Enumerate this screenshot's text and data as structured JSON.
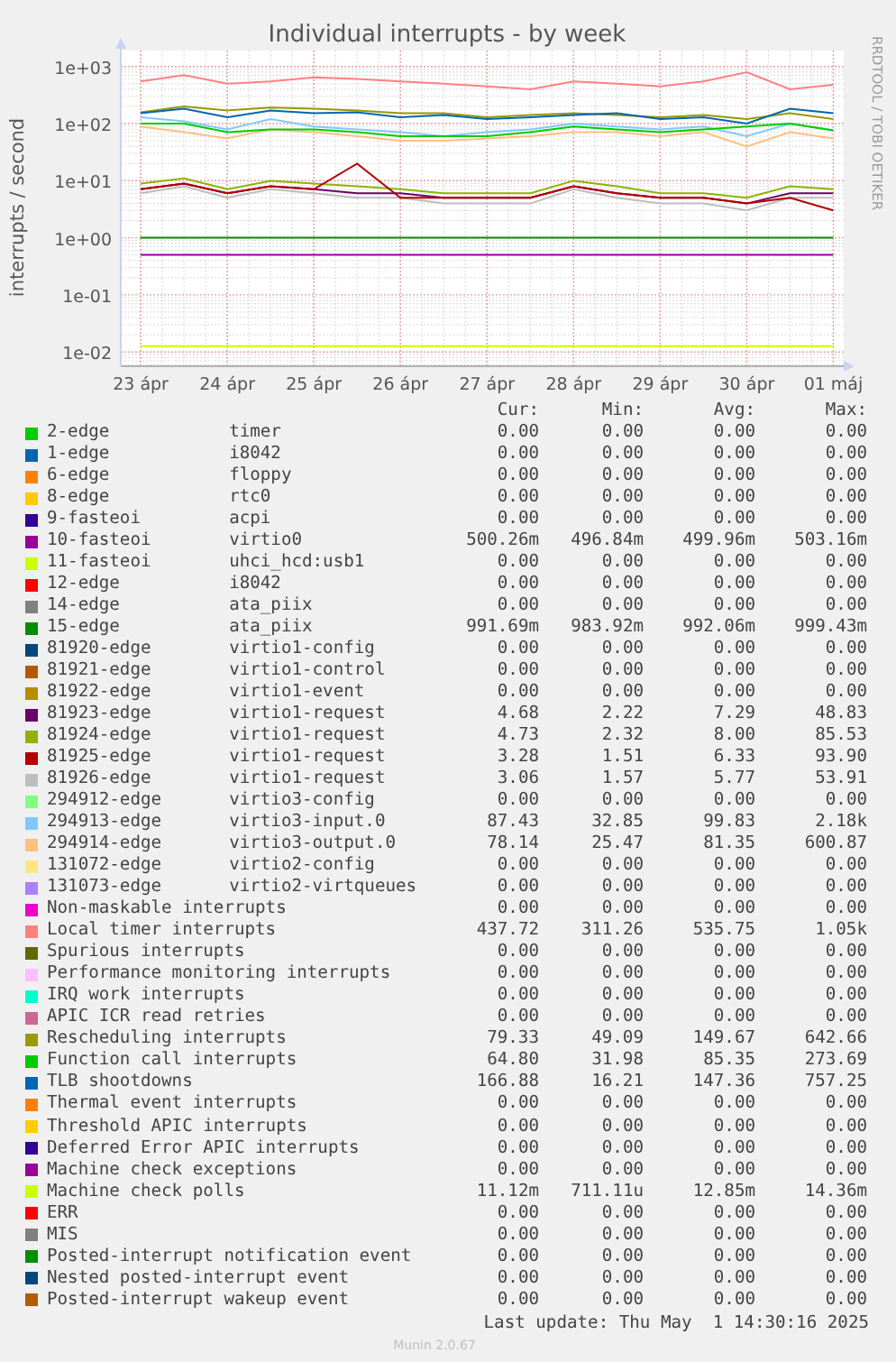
{
  "graph": {
    "title": "Individual interrupts - by week",
    "ylabel": "interrupts / second",
    "x_labels": [
      "23 ápr",
      "24 ápr",
      "25 ápr",
      "26 ápr",
      "27 ápr",
      "28 ápr",
      "29 ápr",
      "30 ápr",
      "01 máj"
    ],
    "y_labels": [
      "1e+03",
      "1e+02",
      "1e+01",
      "1e+00",
      "1e-01",
      "1e-02"
    ]
  },
  "side_label": "RRDTOOL / TOBI OETIKER",
  "legend": {
    "columns": [
      "Cur:",
      "Min:",
      "Avg:",
      "Max:"
    ],
    "rows": [
      {
        "source": "2-edge",
        "device": "timer",
        "color": "#00cc00",
        "cur": "0.00",
        "min": "0.00",
        "avg": "0.00",
        "max": "0.00"
      },
      {
        "source": "1-edge",
        "device": "i8042",
        "color": "#0066b3",
        "cur": "0.00",
        "min": "0.00",
        "avg": "0.00",
        "max": "0.00"
      },
      {
        "source": "6-edge",
        "device": "floppy",
        "color": "#ff8000",
        "cur": "0.00",
        "min": "0.00",
        "avg": "0.00",
        "max": "0.00"
      },
      {
        "source": "8-edge",
        "device": "rtc0",
        "color": "#ffcc00",
        "cur": "0.00",
        "min": "0.00",
        "avg": "0.00",
        "max": "0.00"
      },
      {
        "source": "9-fasteoi",
        "device": "acpi",
        "color": "#330099",
        "cur": "0.00",
        "min": "0.00",
        "avg": "0.00",
        "max": "0.00"
      },
      {
        "source": "10-fasteoi",
        "device": "virtio0",
        "color": "#990099",
        "cur": "500.26m",
        "min": "496.84m",
        "avg": "499.96m",
        "max": "503.16m"
      },
      {
        "source": "11-fasteoi",
        "device": "uhci_hcd:usb1",
        "color": "#ccff00",
        "cur": "0.00",
        "min": "0.00",
        "avg": "0.00",
        "max": "0.00"
      },
      {
        "source": "12-edge",
        "device": "i8042",
        "color": "#ff0000",
        "cur": "0.00",
        "min": "0.00",
        "avg": "0.00",
        "max": "0.00"
      },
      {
        "source": "14-edge",
        "device": "ata_piix",
        "color": "#808080",
        "cur": "0.00",
        "min": "0.00",
        "avg": "0.00",
        "max": "0.00"
      },
      {
        "source": "15-edge",
        "device": "ata_piix",
        "color": "#008f00",
        "cur": "991.69m",
        "min": "983.92m",
        "avg": "992.06m",
        "max": "999.43m"
      },
      {
        "source": "81920-edge",
        "device": "virtio1-config",
        "color": "#00487d",
        "cur": "0.00",
        "min": "0.00",
        "avg": "0.00",
        "max": "0.00"
      },
      {
        "source": "81921-edge",
        "device": "virtio1-control",
        "color": "#b35a00",
        "cur": "0.00",
        "min": "0.00",
        "avg": "0.00",
        "max": "0.00"
      },
      {
        "source": "81922-edge",
        "device": "virtio1-event",
        "color": "#b38f00",
        "cur": "0.00",
        "min": "0.00",
        "avg": "0.00",
        "max": "0.00"
      },
      {
        "source": "81923-edge",
        "device": "virtio1-request",
        "color": "#6b006b",
        "cur": "4.68",
        "min": "2.22",
        "avg": "7.29",
        "max": "48.83"
      },
      {
        "source": "81924-edge",
        "device": "virtio1-request",
        "color": "#8fb300",
        "cur": "4.73",
        "min": "2.32",
        "avg": "8.00",
        "max": "85.53"
      },
      {
        "source": "81925-edge",
        "device": "virtio1-request",
        "color": "#b30000",
        "cur": "3.28",
        "min": "1.51",
        "avg": "6.33",
        "max": "93.90"
      },
      {
        "source": "81926-edge",
        "device": "virtio1-request",
        "color": "#bebebe",
        "cur": "3.06",
        "min": "1.57",
        "avg": "5.77",
        "max": "53.91"
      },
      {
        "source": "294912-edge",
        "device": "virtio3-config",
        "color": "#80ff80",
        "cur": "0.00",
        "min": "0.00",
        "avg": "0.00",
        "max": "0.00"
      },
      {
        "source": "294913-edge",
        "device": "virtio3-input.0",
        "color": "#80c9ff",
        "cur": "87.43",
        "min": "32.85",
        "avg": "99.83",
        "max": "2.18k"
      },
      {
        "source": "294914-edge",
        "device": "virtio3-output.0",
        "color": "#ffc080",
        "cur": "78.14",
        "min": "25.47",
        "avg": "81.35",
        "max": "600.87"
      },
      {
        "source": "131072-edge",
        "device": "virtio2-config",
        "color": "#ffe680",
        "cur": "0.00",
        "min": "0.00",
        "avg": "0.00",
        "max": "0.00"
      },
      {
        "source": "131073-edge",
        "device": "virtio2-virtqueues",
        "color": "#aa80ff",
        "cur": "0.00",
        "min": "0.00",
        "avg": "0.00",
        "max": "0.00"
      },
      {
        "source": "Non-maskable interrupts",
        "color": "#ee00cc",
        "cur": "0.00",
        "min": "0.00",
        "avg": "0.00",
        "max": "0.00"
      },
      {
        "source": "Local timer interrupts",
        "color": "#ff8080",
        "cur": "437.72",
        "min": "311.26",
        "avg": "535.75",
        "max": "1.05k"
      },
      {
        "source": "Spurious interrupts",
        "color": "#666600",
        "cur": "0.00",
        "min": "0.00",
        "avg": "0.00",
        "max": "0.00"
      },
      {
        "source": "Performance monitoring interrupts",
        "color": "#ffbfff",
        "cur": "0.00",
        "min": "0.00",
        "avg": "0.00",
        "max": "0.00"
      },
      {
        "source": "IRQ work interrupts",
        "color": "#00ffcc",
        "cur": "0.00",
        "min": "0.00",
        "avg": "0.00",
        "max": "0.00"
      },
      {
        "source": "APIC ICR read retries",
        "color": "#cc6699",
        "cur": "0.00",
        "min": "0.00",
        "avg": "0.00",
        "max": "0.00"
      },
      {
        "source": "Rescheduling interrupts",
        "color": "#999900",
        "cur": "79.33",
        "min": "49.09",
        "avg": "149.67",
        "max": "642.66"
      },
      {
        "source": "Function call interrupts",
        "color": "#00cc00",
        "cur": "64.80",
        "min": "31.98",
        "avg": "85.35",
        "max": "273.69"
      },
      {
        "source": "TLB shootdowns",
        "color": "#0066b3",
        "cur": "166.88",
        "min": "16.21",
        "avg": "147.36",
        "max": "757.25"
      },
      {
        "source": "Thermal event interrupts",
        "color": "#ff8000",
        "cur": "0.00",
        "min": "0.00",
        "avg": "0.00",
        "max": "0.00"
      },
      {
        "source": "Threshold APIC interrupts",
        "color": "#ffcc00",
        "cur": "0.00",
        "min": "0.00",
        "avg": "0.00",
        "max": "0.00"
      },
      {
        "source": "Deferred Error APIC interrupts",
        "color": "#330099",
        "cur": "0.00",
        "min": "0.00",
        "avg": "0.00",
        "max": "0.00"
      },
      {
        "source": "Machine check exceptions",
        "color": "#990099",
        "cur": "0.00",
        "min": "0.00",
        "avg": "0.00",
        "max": "0.00"
      },
      {
        "source": "Machine check polls",
        "color": "#ccff00",
        "cur": "11.12m",
        "min": "711.11u",
        "avg": "12.85m",
        "max": "14.36m"
      },
      {
        "source": "ERR",
        "color": "#ff0000",
        "cur": "0.00",
        "min": "0.00",
        "avg": "0.00",
        "max": "0.00"
      },
      {
        "source": "MIS",
        "color": "#808080",
        "cur": "0.00",
        "min": "0.00",
        "avg": "0.00",
        "max": "0.00"
      },
      {
        "source": "Posted-interrupt notification event",
        "color": "#008f00",
        "cur": "0.00",
        "min": "0.00",
        "avg": "0.00",
        "max": "0.00"
      },
      {
        "source": "Nested posted-interrupt event",
        "color": "#00487d",
        "cur": "0.00",
        "min": "0.00",
        "avg": "0.00",
        "max": "0.00"
      },
      {
        "source": "Posted-interrupt wakeup event",
        "color": "#b35a00",
        "cur": "0.00",
        "min": "0.00",
        "avg": "0.00",
        "max": "0.00"
      }
    ]
  },
  "last_update": "Last update: Thu May  1 14:30:16 2025",
  "footer": "Munin 2.0.67"
}
